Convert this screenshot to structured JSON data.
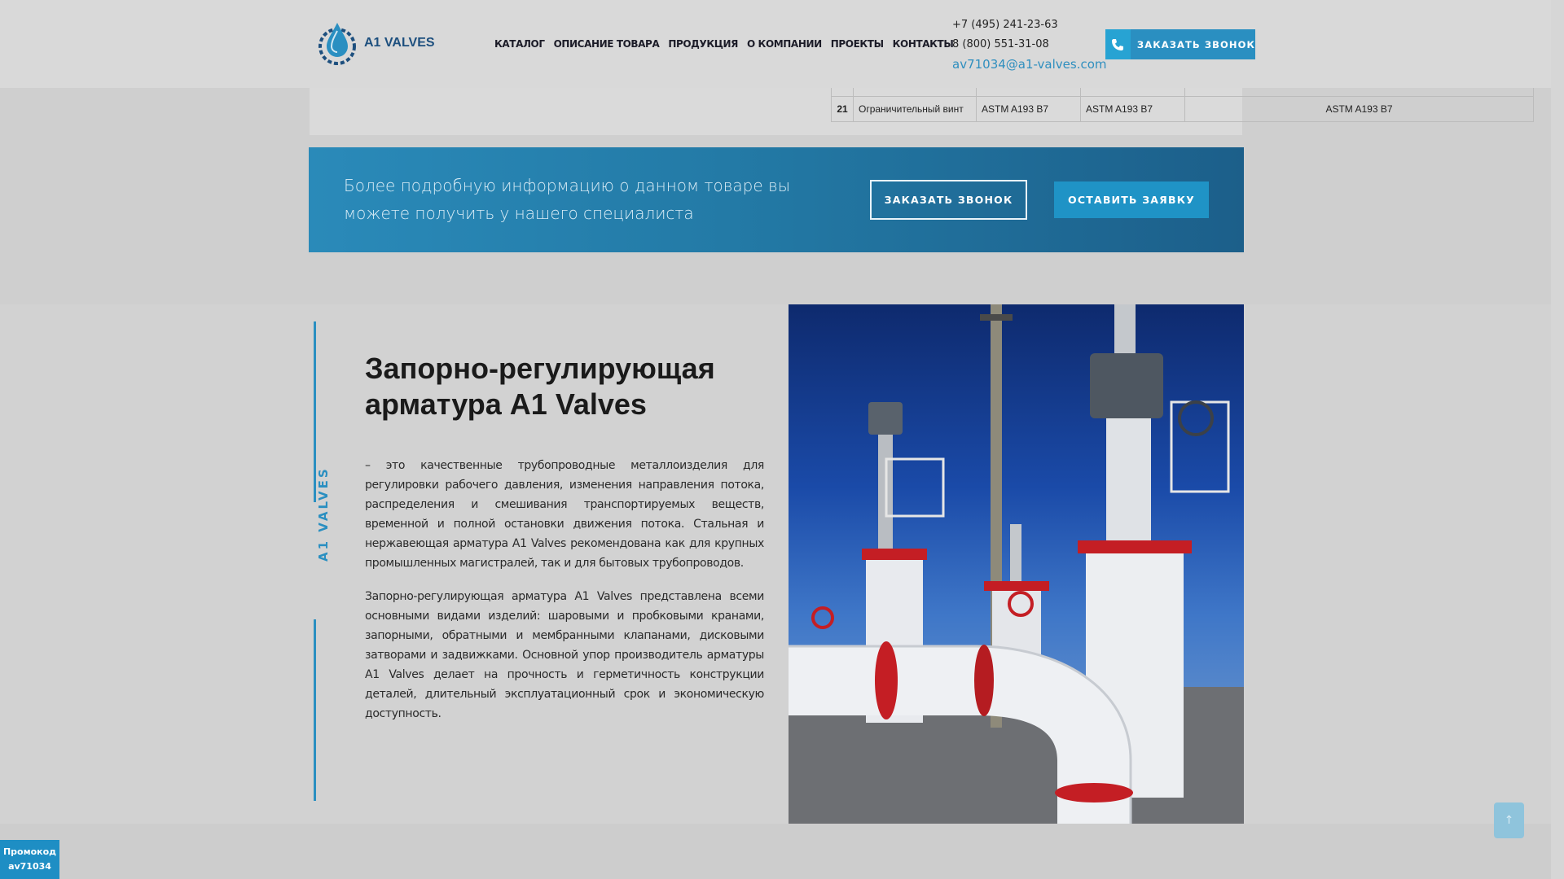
{
  "header": {
    "logo_text": "A1 VALVES",
    "nav": [
      "КАТАЛОГ",
      "ОПИСАНИЕ ТОВАРА",
      "ПРОДУКЦИЯ",
      "О КОМПАНИИ",
      "ПРОЕКТЫ",
      "КОНТАКТЫ"
    ],
    "phone1": "+7 (495) 241-23-63",
    "phone2": "8 (800) 551-31-08",
    "email": "av71034@a1-valves.com",
    "call_button": "ЗАКАЗАТЬ ЗВОНОК"
  },
  "spec_table": {
    "rows": [
      {
        "num": "21",
        "name": "Ограничительный винт",
        "col2": "ASTM A193 B7",
        "col3": "ASTM A193 B7",
        "col4": "ASTM A193 B7"
      }
    ]
  },
  "cta": {
    "text": "Более подробную информацию о данном товаре вы можете получить у нашего специалиста",
    "call_button": "ЗАКАЗАТЬ ЗВОНОК",
    "request_button": "ОСТАВИТЬ ЗАЯВКУ"
  },
  "article": {
    "side_label": "A1 VALVES",
    "title": "Запорно-регулирующая арматура A1 Valves",
    "paragraph1": "– это качественные трубопроводные металлоизделия для регулировки рабочего давления, изменения направления потока, распределения и смешивания транспортируемых веществ, временной и полной остановки движения потока. Стальная и нержавеющая арматура A1 Valves рекомендована как для крупных промышленных магистралей, так и для бытовых трубопроводов.",
    "paragraph2": "Запорно-регулирующая арматура A1 Valves представлена всеми основными видами изделий: шаровыми и пробковыми кранами, запорными, обратными и мембранными клапанами, дисковыми затворами и задвижками. Основной упор производитель арматуры A1 Valves делает на прочность и герметичность конструкции деталей, длительный эксплуатационный срок и экономическую доступность."
  },
  "promo": {
    "label": "Промокод",
    "code": "av71034"
  },
  "scroll_top_icon": "arrow-up-icon",
  "colors": {
    "accent": "#2a8fc1",
    "cta_start": "#2a8ab9",
    "cta_end": "#1c5f8a"
  }
}
